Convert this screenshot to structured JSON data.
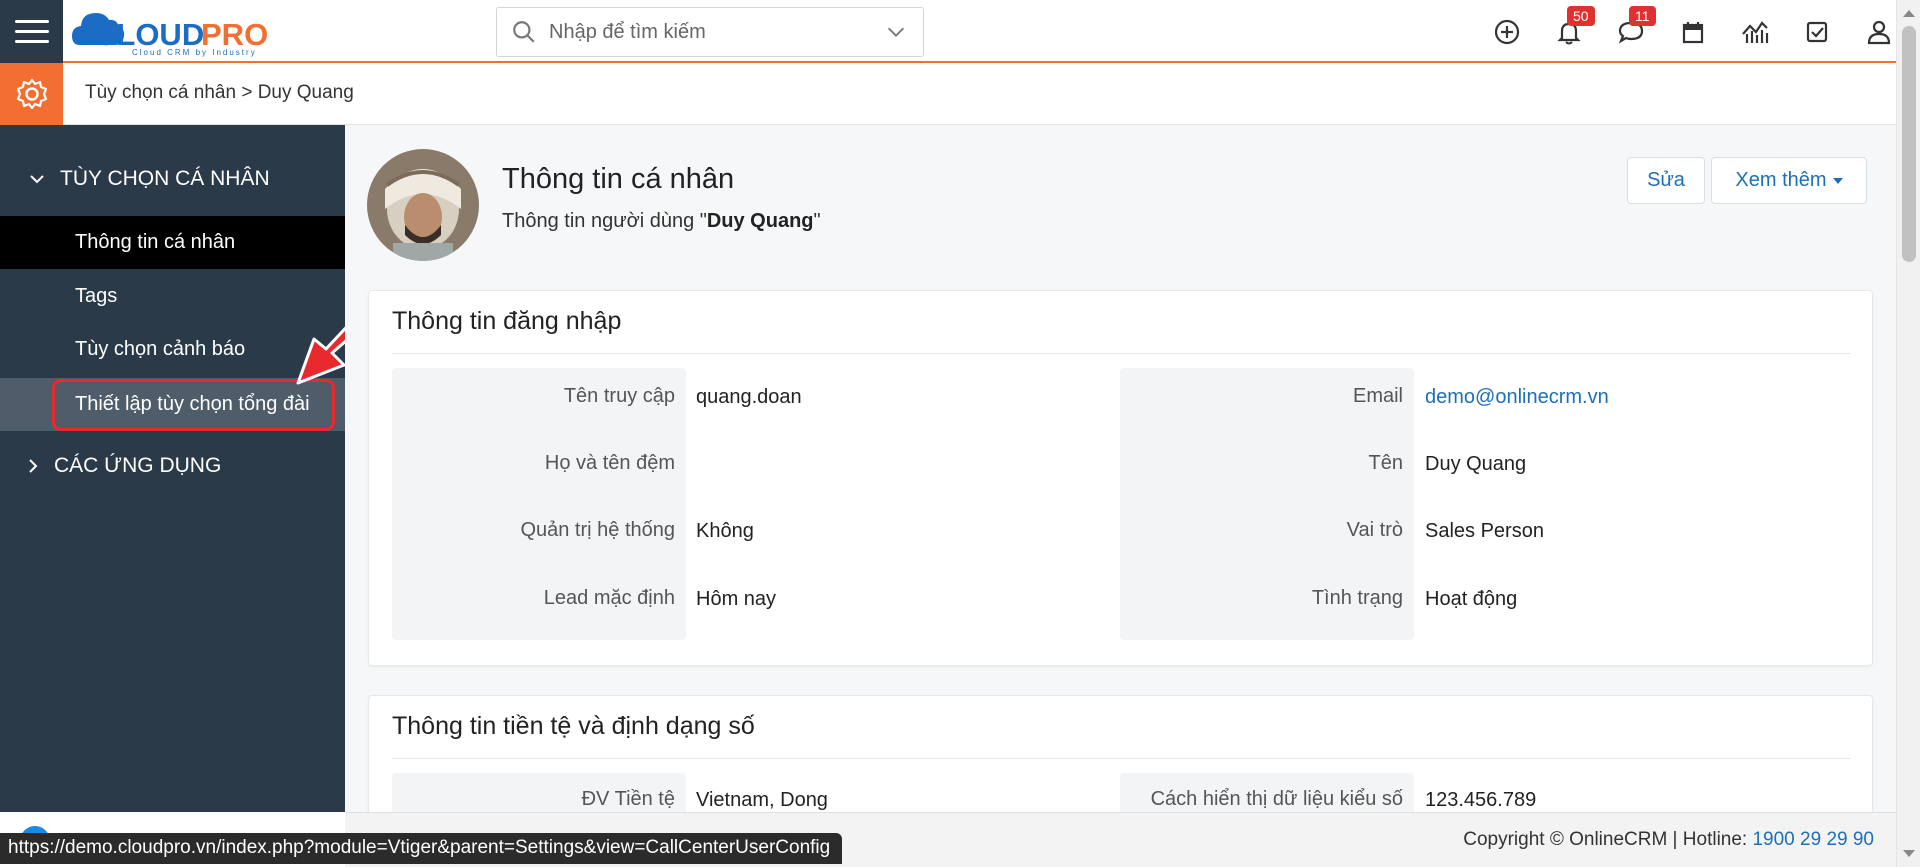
{
  "header": {
    "logo_text": "CLOUDPRO",
    "logo_tagline": "Cloud CRM by Industry",
    "search_placeholder": "Nhập để tìm kiếm",
    "notifications_count": "50",
    "messages_count": "11"
  },
  "breadcrumb": {
    "text": "Tùy chọn cá nhân > Duy Quang"
  },
  "sidebar": {
    "section1": "TÙY CHỌN CÁ NHÂN",
    "items": [
      {
        "label": "Thông tin cá nhân"
      },
      {
        "label": "Tags"
      },
      {
        "label": "Tùy chọn cảnh báo"
      },
      {
        "label": "Thiết lập tùy chọn tổng đài"
      }
    ],
    "section2": "CÁC ỨNG DỤNG"
  },
  "profile": {
    "title": "Thông tin cá nhân",
    "subtitle_prefix": "Thông tin người dùng  \"",
    "subtitle_name": "Duy Quang",
    "subtitle_suffix": "\"",
    "edit_button": "Sửa",
    "more_button": "Xem thêm"
  },
  "login_card": {
    "title": "Thông tin đăng nhập",
    "left_fields": [
      {
        "label": "Tên truy cập",
        "value": "quang.doan"
      },
      {
        "label": "Họ và tên đệm",
        "value": ""
      },
      {
        "label": "Quản trị hệ thống",
        "value": "Không"
      },
      {
        "label": "Lead mặc định",
        "value": "Hôm nay"
      }
    ],
    "right_fields": [
      {
        "label": "Email",
        "value": "demo@onlinecrm.vn"
      },
      {
        "label": "Tên",
        "value": "Duy Quang"
      },
      {
        "label": "Vai trò",
        "value": "Sales Person"
      },
      {
        "label": "Tình trạng",
        "value": "Hoạt động"
      }
    ]
  },
  "currency_card": {
    "title": "Thông tin tiền tệ và định dạng số",
    "left_label": "ĐV Tiền tệ",
    "left_value": "Vietnam, Dong",
    "right_label": "Cách hiển thị dữ liệu kiểu số",
    "right_value": "123.456.789"
  },
  "footer": {
    "copyright": "Copyright © OnlineCRM | Hotline: ",
    "hotline": "1900 29 29 90"
  },
  "status_bar": {
    "url": "https://demo.cloudpro.vn/index.php?module=Vtiger&parent=Settings&view=CallCenterUserConfig"
  },
  "colors": {
    "accent": "#f26f31",
    "sidebar_bg": "#2b3a48",
    "link": "#1d6fb8",
    "highlight_red": "#e8292d"
  }
}
